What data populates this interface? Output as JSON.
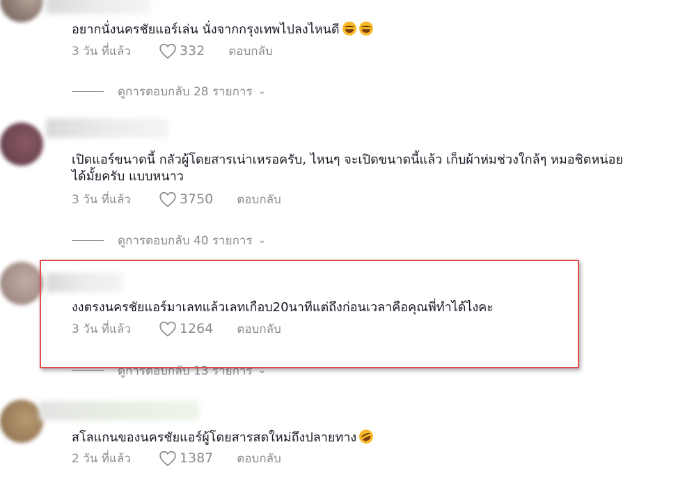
{
  "comments": [
    {
      "text": "อยากนั่งนครชัยแอร์เล่น นั่งจากกรุงเทพไปลงไหนดี",
      "emoji": [
        "laughing-tears-emoji",
        "laughing-tears-emoji"
      ],
      "time": "3 วัน ที่แล้ว",
      "likes": "332",
      "reply_label": "ตอบกลับ",
      "view_replies": "ดูการตอบกลับ 28 รายการ"
    },
    {
      "text_line1": "เปิดแอร์ขนาดนี้ กลัวผู้โดยสารเน่าเหรอครับ, ไหนๆ จะเปิดขนาดนี้แล้ว เก็บผ้าห่มช่วงใกล้ๆ หมอชิตหน่อย",
      "text_line2": "ได้มั้ยครับ แบบหนาว",
      "time": "3 วัน ที่แล้ว",
      "likes": "3750",
      "reply_label": "ตอบกลับ",
      "view_replies": "ดูการตอบกลับ 40 รายการ"
    },
    {
      "text": "งงตรงนครชัยแอร์มาเลทแล้วเลทเกือบ20นาทีแต่ถึงก่อนเวลาคือคุณพี่ทำได้ไงคะ",
      "time": "3 วัน ที่แล้ว",
      "likes": "1264",
      "reply_label": "ตอบกลับ",
      "view_replies": "ดูการตอบกลับ 13 รายการ"
    },
    {
      "text": "สโลแกนของนครชัยแอร์ผู้โดยสารสดใหม่ถึงปลายทาง",
      "emoji": [
        "rofl-emoji"
      ],
      "time": "2 วัน ที่แล้ว",
      "likes": "1387",
      "reply_label": "ตอบกลับ"
    }
  ],
  "colors": {
    "highlight": "#e04c4c",
    "meta_text": "#8a8b91",
    "body_text": "#161823"
  }
}
